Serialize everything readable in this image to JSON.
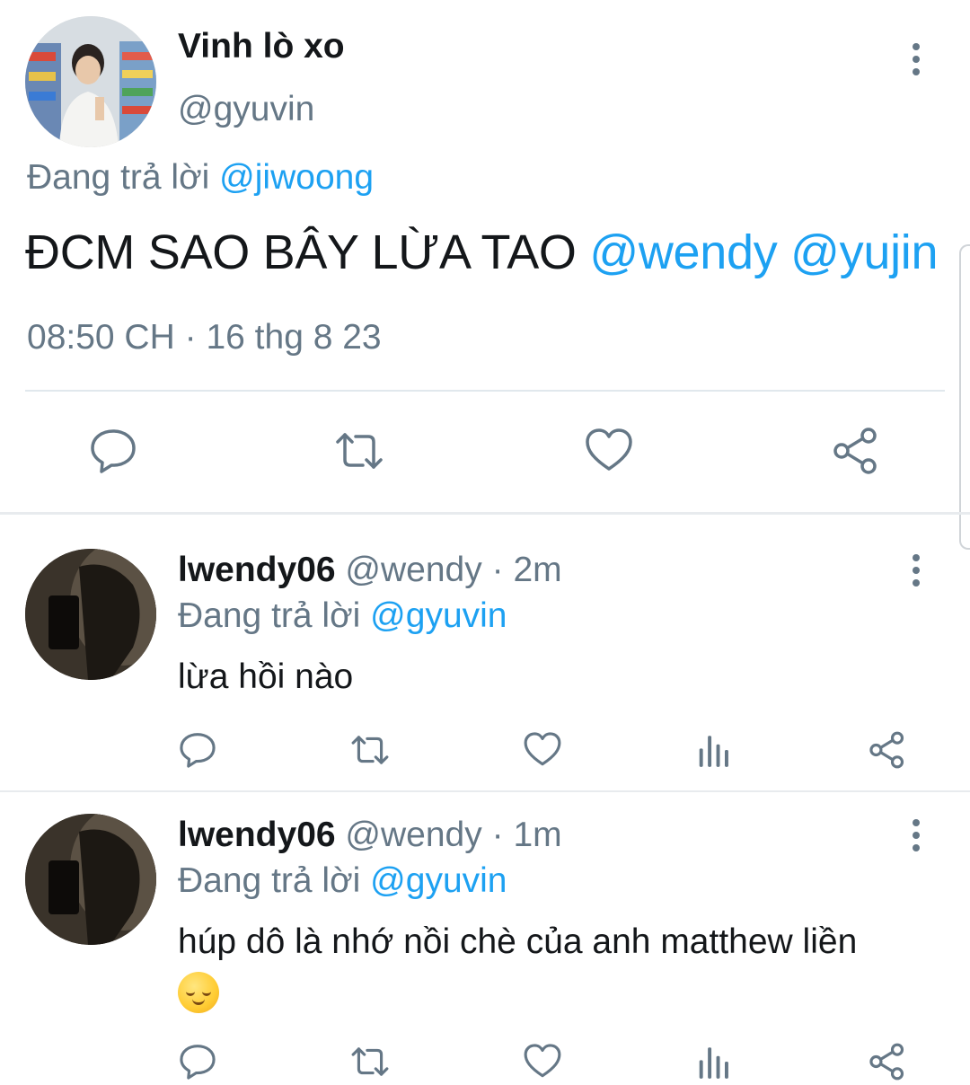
{
  "colors": {
    "text": "#14171a",
    "secondary": "#657786",
    "link": "#1da1f2",
    "divider": "#e1e8ed",
    "icon": "#657786"
  },
  "main_tweet": {
    "display_name": "Vinh lò xo",
    "handle": "@gyuvin",
    "replying_label": "Đang trả lời",
    "replying_to": "@jiwoong",
    "text": "ĐCM SAO BÂY LỪA TAO",
    "mentions": [
      "@wendy",
      "@yujin"
    ],
    "time": "08:50 CH",
    "separator": "·",
    "date": "16 thg 8 23",
    "actions": [
      "reply-icon",
      "retweet-icon",
      "like-icon",
      "share-icon"
    ],
    "more_icon": "more-vertical-icon"
  },
  "replies": [
    {
      "display_name": "lwendy06",
      "handle": "@wendy",
      "separator": "·",
      "time": "2m",
      "replying_label": "Đang trả lời",
      "replying_to": "@gyuvin",
      "text": "lừa hồi nào",
      "emoji": "",
      "actions": [
        "reply-icon",
        "retweet-icon",
        "like-icon",
        "analytics-icon",
        "share-icon"
      ]
    },
    {
      "display_name": "lwendy06",
      "handle": "@wendy",
      "separator": "·",
      "time": "1m",
      "replying_label": "Đang trả lời",
      "replying_to": "@gyuvin",
      "text": "húp dô là nhớ nồi chè của anh matthew liền",
      "emoji": "relieved-face-emoji",
      "actions": [
        "reply-icon",
        "retweet-icon",
        "like-icon",
        "analytics-icon",
        "share-icon"
      ]
    }
  ]
}
